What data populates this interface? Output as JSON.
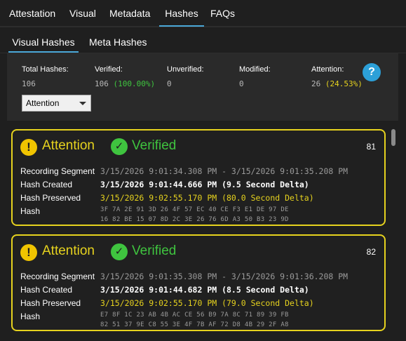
{
  "nav": {
    "tabs": [
      "Attestation",
      "Visual",
      "Metadata",
      "Hashes",
      "FAQs"
    ],
    "active": "Hashes"
  },
  "subnav": {
    "tabs": [
      "Visual Hashes",
      "Meta Hashes"
    ],
    "active": "Visual Hashes"
  },
  "summary": {
    "total_label": "Total Hashes:",
    "total_value": "106",
    "verified_label": "Verified:",
    "verified_value": "106",
    "verified_pct": "(100.00%)",
    "unverified_label": "Unverified:",
    "unverified_value": "0",
    "modified_label": "Modified:",
    "modified_value": "0",
    "attention_label": "Attention:",
    "attention_value": "26",
    "attention_pct": "(24.53%)",
    "help_glyph": "?",
    "filter_selected": "Attention"
  },
  "cards": [
    {
      "status": "Attention",
      "verification": "Verified",
      "number": "81",
      "labels": {
        "segment": "Recording Segment",
        "created": "Hash Created",
        "preserved": "Hash Preserved",
        "hash": "Hash"
      },
      "segment": "3/15/2026 9:01:34.308 PM - 3/15/2026 9:01:35.208 PM",
      "created": "3/15/2026 9:01:44.666 PM (9.5 Second Delta)",
      "preserved": "3/15/2026 9:02:55.170 PM (80.0 Second Delta)",
      "hash_line1": "3F  7A  2E  91  3D  26  4F  57  EC  40  CE  F3  E1  DE  97  DE",
      "hash_line2": "16  82  BE  15  07  8D  2C  3E  26  76  6D  A3  50  B3  23  9D"
    },
    {
      "status": "Attention",
      "verification": "Verified",
      "number": "82",
      "labels": {
        "segment": "Recording Segment",
        "created": "Hash Created",
        "preserved": "Hash Preserved",
        "hash": "Hash"
      },
      "segment": "3/15/2026 9:01:35.308 PM - 3/15/2026 9:01:36.208 PM",
      "created": "3/15/2026 9:01:44.682 PM (8.5 Second Delta)",
      "preserved": "3/15/2026 9:02:55.170 PM (79.0 Second Delta)",
      "hash_line1": "E7  8F  1C  23  AB  4B  AC  CE  56  B9  7A  8C  71  89  39  FB",
      "hash_line2": "82  51  37  9E  C8  55  3E  4F  7B  AF  72  D8  4B  29  2F  A8"
    }
  ],
  "colors": {
    "accent": "#4aa8d8",
    "attention": "#e6d21e",
    "verified": "#3fc43f",
    "background": "#1f1f1f"
  }
}
